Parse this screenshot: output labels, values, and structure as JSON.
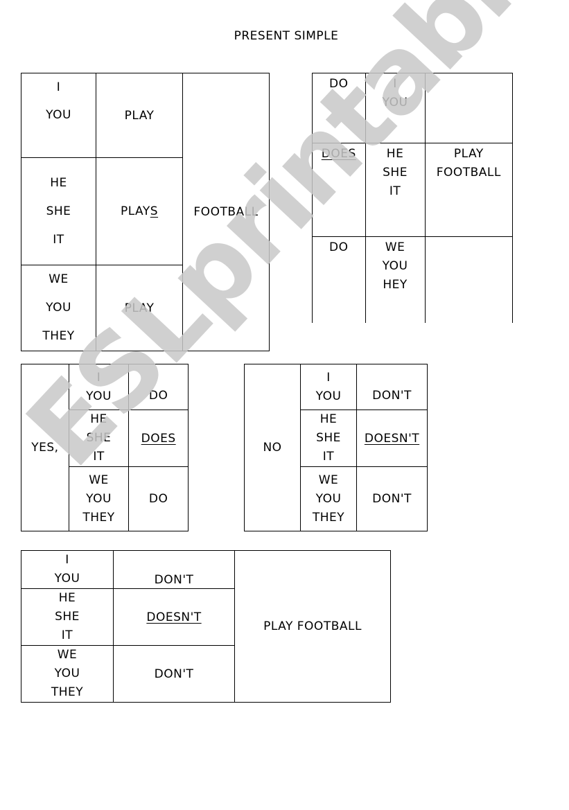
{
  "title": "PRESENT SIMPLE",
  "watermark": "ESLprintables.com",
  "table1": {
    "rows": [
      {
        "subjects": [
          "I",
          "YOU"
        ],
        "verb": "PLAY"
      },
      {
        "subjects": [
          "HE",
          "SHE",
          "IT"
        ],
        "verb_base": "PLAY",
        "verb_suffix": "S"
      },
      {
        "subjects": [
          "WE",
          "YOU",
          "THEY"
        ],
        "verb": "PLAY"
      }
    ],
    "object": "FOOTBALL"
  },
  "table2": {
    "rows": [
      {
        "aux": "DO",
        "subjects": [
          "I",
          "YOU"
        ],
        "rest": ""
      },
      {
        "aux": "DOES",
        "subjects": [
          "HE",
          "SHE",
          "IT"
        ],
        "rest": [
          "PLAY",
          "FOOTBALL"
        ]
      },
      {
        "aux": "DO",
        "subjects": [
          "WE",
          "YOU",
          "HEY"
        ],
        "rest": ""
      }
    ]
  },
  "table3": {
    "answer": "YES,",
    "rows": [
      {
        "subjects": [
          "I",
          "YOU"
        ],
        "aux": "DO"
      },
      {
        "subjects": [
          "HE",
          "SHE",
          "IT"
        ],
        "aux": "DOES"
      },
      {
        "subjects": [
          "WE",
          "YOU",
          "THEY"
        ],
        "aux": "DO"
      }
    ]
  },
  "table4": {
    "answer": "NO",
    "rows": [
      {
        "subjects": [
          "I",
          "YOU"
        ],
        "aux": "DON'T"
      },
      {
        "subjects": [
          "HE",
          "SHE",
          "IT"
        ],
        "aux": "DOESN'T"
      },
      {
        "subjects": [
          "WE",
          "YOU",
          "THEY"
        ],
        "aux": "DON'T"
      }
    ]
  },
  "table5": {
    "rows": [
      {
        "subjects": [
          "I",
          "YOU"
        ],
        "aux": "DON'T"
      },
      {
        "subjects": [
          "HE",
          "SHE",
          "IT"
        ],
        "aux": "DOESN'T"
      },
      {
        "subjects": [
          "WE",
          "YOU",
          "THEY"
        ],
        "aux": "DON'T"
      }
    ],
    "rest": "PLAY FOOTBALL"
  }
}
